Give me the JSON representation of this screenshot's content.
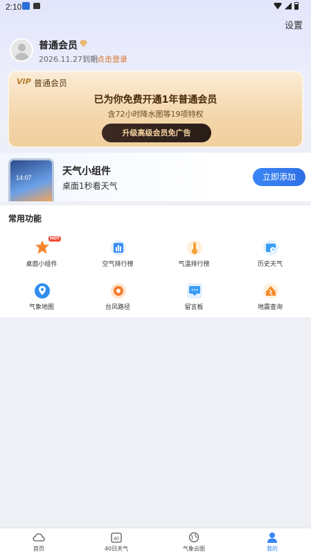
{
  "status_bar": {
    "time": "2:10"
  },
  "header": {
    "settings_label": "设置"
  },
  "profile": {
    "name": "普通会员",
    "expire_date": "2026.11.27到期",
    "login_link": "点击登录"
  },
  "vip_card": {
    "badge": "VIP",
    "tier": "普通会员",
    "title": "已为你免费开通1年普通会员",
    "subtitle": "含72小时降水图等19项特权",
    "button": "升级高级会员免广告"
  },
  "widget_promo": {
    "phone_time": "14:07",
    "title": "天气小组件",
    "subtitle": "桌面1秒看天气",
    "button": "立即添加"
  },
  "functions": {
    "title": "常用功能",
    "hot_badge": "HOT",
    "items": [
      {
        "label": "桌面小组件",
        "icon": "widget-icon",
        "color": "#f5842c"
      },
      {
        "label": "空气排行榜",
        "icon": "air-ranking-icon",
        "color": "#3a8ef5"
      },
      {
        "label": "气温排行榜",
        "icon": "thermometer-icon",
        "color": "#f5a23a"
      },
      {
        "label": "历史天气",
        "icon": "history-weather-icon",
        "color": "#3aa0f5"
      },
      {
        "label": "气象地图",
        "icon": "map-pin-icon",
        "color": "#2f8ef0"
      },
      {
        "label": "台风路径",
        "icon": "typhoon-icon",
        "color": "#f57c2c"
      },
      {
        "label": "留言板",
        "icon": "message-board-icon",
        "color": "#3a9cf5"
      },
      {
        "label": "地震查询",
        "icon": "earthquake-icon",
        "color": "#f58a2c"
      }
    ]
  },
  "bottom_nav": {
    "items": [
      {
        "label": "首页",
        "icon": "cloud-home-icon"
      },
      {
        "label": "40日天气",
        "icon": "calendar-40-icon",
        "badge": "40"
      },
      {
        "label": "气象云图",
        "icon": "globe-icon"
      },
      {
        "label": "我的",
        "icon": "profile-icon"
      }
    ],
    "active_color": "#3a86f5"
  }
}
